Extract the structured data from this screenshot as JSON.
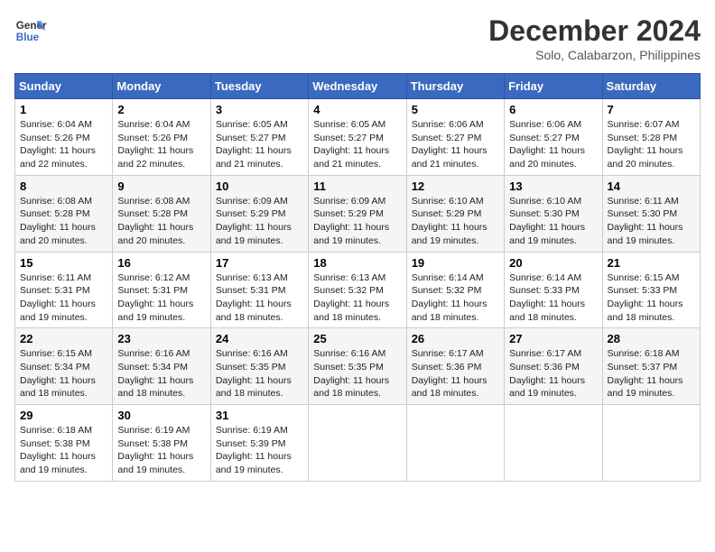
{
  "header": {
    "logo_line1": "General",
    "logo_line2": "Blue",
    "month": "December 2024",
    "location": "Solo, Calabarzon, Philippines"
  },
  "weekdays": [
    "Sunday",
    "Monday",
    "Tuesday",
    "Wednesday",
    "Thursday",
    "Friday",
    "Saturday"
  ],
  "weeks": [
    [
      {
        "day": "1",
        "sunrise": "6:04 AM",
        "sunset": "5:26 PM",
        "daylight": "11 hours and 22 minutes."
      },
      {
        "day": "2",
        "sunrise": "6:04 AM",
        "sunset": "5:26 PM",
        "daylight": "11 hours and 22 minutes."
      },
      {
        "day": "3",
        "sunrise": "6:05 AM",
        "sunset": "5:27 PM",
        "daylight": "11 hours and 21 minutes."
      },
      {
        "day": "4",
        "sunrise": "6:05 AM",
        "sunset": "5:27 PM",
        "daylight": "11 hours and 21 minutes."
      },
      {
        "day": "5",
        "sunrise": "6:06 AM",
        "sunset": "5:27 PM",
        "daylight": "11 hours and 21 minutes."
      },
      {
        "day": "6",
        "sunrise": "6:06 AM",
        "sunset": "5:27 PM",
        "daylight": "11 hours and 20 minutes."
      },
      {
        "day": "7",
        "sunrise": "6:07 AM",
        "sunset": "5:28 PM",
        "daylight": "11 hours and 20 minutes."
      }
    ],
    [
      {
        "day": "8",
        "sunrise": "6:08 AM",
        "sunset": "5:28 PM",
        "daylight": "11 hours and 20 minutes."
      },
      {
        "day": "9",
        "sunrise": "6:08 AM",
        "sunset": "5:28 PM",
        "daylight": "11 hours and 20 minutes."
      },
      {
        "day": "10",
        "sunrise": "6:09 AM",
        "sunset": "5:29 PM",
        "daylight": "11 hours and 19 minutes."
      },
      {
        "day": "11",
        "sunrise": "6:09 AM",
        "sunset": "5:29 PM",
        "daylight": "11 hours and 19 minutes."
      },
      {
        "day": "12",
        "sunrise": "6:10 AM",
        "sunset": "5:29 PM",
        "daylight": "11 hours and 19 minutes."
      },
      {
        "day": "13",
        "sunrise": "6:10 AM",
        "sunset": "5:30 PM",
        "daylight": "11 hours and 19 minutes."
      },
      {
        "day": "14",
        "sunrise": "6:11 AM",
        "sunset": "5:30 PM",
        "daylight": "11 hours and 19 minutes."
      }
    ],
    [
      {
        "day": "15",
        "sunrise": "6:11 AM",
        "sunset": "5:31 PM",
        "daylight": "11 hours and 19 minutes."
      },
      {
        "day": "16",
        "sunrise": "6:12 AM",
        "sunset": "5:31 PM",
        "daylight": "11 hours and 19 minutes."
      },
      {
        "day": "17",
        "sunrise": "6:13 AM",
        "sunset": "5:31 PM",
        "daylight": "11 hours and 18 minutes."
      },
      {
        "day": "18",
        "sunrise": "6:13 AM",
        "sunset": "5:32 PM",
        "daylight": "11 hours and 18 minutes."
      },
      {
        "day": "19",
        "sunrise": "6:14 AM",
        "sunset": "5:32 PM",
        "daylight": "11 hours and 18 minutes."
      },
      {
        "day": "20",
        "sunrise": "6:14 AM",
        "sunset": "5:33 PM",
        "daylight": "11 hours and 18 minutes."
      },
      {
        "day": "21",
        "sunrise": "6:15 AM",
        "sunset": "5:33 PM",
        "daylight": "11 hours and 18 minutes."
      }
    ],
    [
      {
        "day": "22",
        "sunrise": "6:15 AM",
        "sunset": "5:34 PM",
        "daylight": "11 hours and 18 minutes."
      },
      {
        "day": "23",
        "sunrise": "6:16 AM",
        "sunset": "5:34 PM",
        "daylight": "11 hours and 18 minutes."
      },
      {
        "day": "24",
        "sunrise": "6:16 AM",
        "sunset": "5:35 PM",
        "daylight": "11 hours and 18 minutes."
      },
      {
        "day": "25",
        "sunrise": "6:16 AM",
        "sunset": "5:35 PM",
        "daylight": "11 hours and 18 minutes."
      },
      {
        "day": "26",
        "sunrise": "6:17 AM",
        "sunset": "5:36 PM",
        "daylight": "11 hours and 18 minutes."
      },
      {
        "day": "27",
        "sunrise": "6:17 AM",
        "sunset": "5:36 PM",
        "daylight": "11 hours and 19 minutes."
      },
      {
        "day": "28",
        "sunrise": "6:18 AM",
        "sunset": "5:37 PM",
        "daylight": "11 hours and 19 minutes."
      }
    ],
    [
      {
        "day": "29",
        "sunrise": "6:18 AM",
        "sunset": "5:38 PM",
        "daylight": "11 hours and 19 minutes."
      },
      {
        "day": "30",
        "sunrise": "6:19 AM",
        "sunset": "5:38 PM",
        "daylight": "11 hours and 19 minutes."
      },
      {
        "day": "31",
        "sunrise": "6:19 AM",
        "sunset": "5:39 PM",
        "daylight": "11 hours and 19 minutes."
      },
      null,
      null,
      null,
      null
    ]
  ]
}
